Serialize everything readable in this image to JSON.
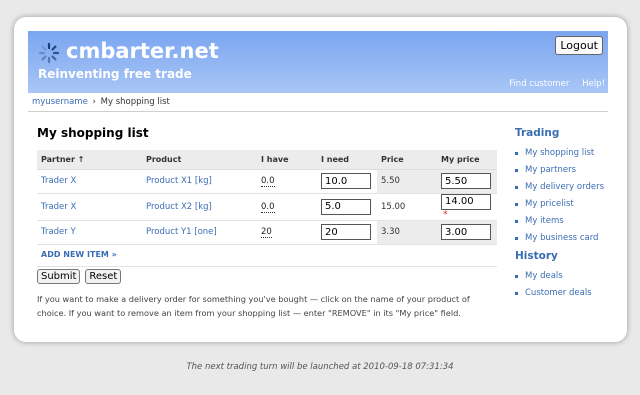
{
  "header": {
    "brand": "cmbarter.net",
    "tagline": "Reinventing free trade",
    "logout_label": "Logout",
    "links": [
      "Find customer",
      "Help!"
    ],
    "bg_colors": [
      "#7aa5f0",
      "#a9c6f6"
    ]
  },
  "breadcrumb": {
    "user": "myusername",
    "separator": "›",
    "current": "My shopping list"
  },
  "main": {
    "title": "My shopping list",
    "columns": [
      "Partner ↑",
      "Product",
      "I have",
      "I need",
      "Price",
      "My price"
    ],
    "rows": [
      {
        "partner": "Trader X",
        "product": "Product X1 [kg]",
        "have": "0.0",
        "need": "10.0",
        "price": "5.50",
        "my_price": "5.50",
        "flag": ""
      },
      {
        "partner": "Trader X",
        "product": "Product X2 [kg]",
        "have": "0.0",
        "need": "5.0",
        "price": "15.00",
        "my_price": "14.00",
        "flag": "*"
      },
      {
        "partner": "Trader Y",
        "product": "Product Y1 [one]",
        "have": "20",
        "need": "20",
        "price": "3.30",
        "my_price": "3.00",
        "flag": ""
      }
    ],
    "add_item": "ADD NEW ITEM »",
    "submit_label": "Submit",
    "reset_label": "Reset",
    "help_text": "If you want to make a delivery order for something you've bought — click on the name of your product of choice. If you want to remove an item from your shopping list — enter \"REMOVE\" in its \"My price\" field."
  },
  "sidebar": {
    "trading_title": "Trading",
    "trading_items": [
      "My shopping list",
      "My partners",
      "My delivery orders",
      "My pricelist",
      "My items",
      "My business card"
    ],
    "history_title": "History",
    "history_items": [
      "My deals",
      "Customer deals"
    ]
  },
  "footer": {
    "text": "The next trading turn will be launched at 2010-09-18 07:31:34"
  }
}
